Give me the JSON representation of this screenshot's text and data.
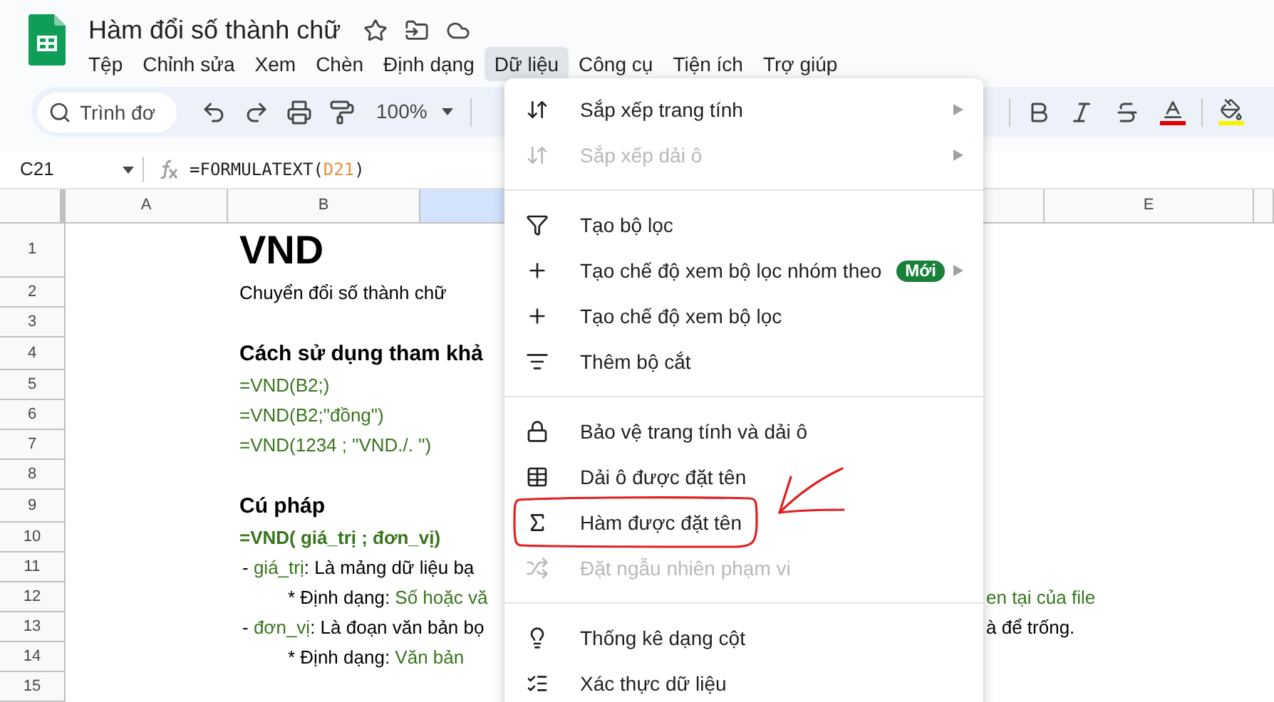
{
  "document": {
    "title": "Hàm đổi số thành chữ"
  },
  "menu_bar": [
    {
      "label": "Tệp",
      "selected": false
    },
    {
      "label": "Chỉnh sửa",
      "selected": false
    },
    {
      "label": "Xem",
      "selected": false
    },
    {
      "label": "Chèn",
      "selected": false
    },
    {
      "label": "Định dạng",
      "selected": false
    },
    {
      "label": "Dữ liệu",
      "selected": true
    },
    {
      "label": "Công cụ",
      "selected": false
    },
    {
      "label": "Tiện ích",
      "selected": false
    },
    {
      "label": "Trợ giúp",
      "selected": false
    }
  ],
  "toolbar": {
    "search": {
      "placeholder": "Trình đơ"
    },
    "zoom": "100%"
  },
  "formula_bar": {
    "name_box": "C21",
    "formula": [
      {
        "text": "=FORMULATEXT(",
        "reference": false
      },
      {
        "text": "D21",
        "reference": true
      },
      {
        "text": ")",
        "reference": false
      }
    ]
  },
  "columns": [
    {
      "label": "A",
      "selected": false
    },
    {
      "label": "B",
      "selected": false
    },
    {
      "selected": true
    },
    {
      "selected": false
    },
    {
      "label": "E",
      "selected": false
    },
    {
      "selected": false
    }
  ],
  "rows": [
    {
      "number": "1",
      "kind": "title",
      "left": [
        {
          "text": "VND",
          "accent": false
        }
      ]
    },
    {
      "number": "2",
      "kind": "normal",
      "left": [
        {
          "text": "Chuyển đổi số thành chữ",
          "accent": false
        }
      ]
    },
    {
      "number": "3",
      "kind": "normal"
    },
    {
      "number": "4",
      "kind": "heading",
      "left": [
        {
          "text": "Cách sử dụng tham khả",
          "accent": false
        }
      ]
    },
    {
      "number": "5",
      "kind": "normal",
      "left": [
        {
          "text": "=VND(B2;)",
          "accent": true
        }
      ]
    },
    {
      "number": "6",
      "kind": "normal",
      "left": [
        {
          "text": "=VND(B2;\"đồng\")",
          "accent": true
        }
      ]
    },
    {
      "number": "7",
      "kind": "normal",
      "left": [
        {
          "text": "=VND(1234 ; \"VND./. \")",
          "accent": true
        }
      ]
    },
    {
      "number": "8",
      "kind": "normal"
    },
    {
      "number": "9",
      "kind": "heading",
      "left": [
        {
          "text": "Cú pháp",
          "accent": false
        }
      ]
    },
    {
      "number": "10",
      "kind": "syntax",
      "left": [
        {
          "text": "=VND( giá_trị ; đơn_vị)",
          "accent": true
        }
      ]
    },
    {
      "number": "11",
      "kind": "item",
      "left": [
        {
          "text": "- ",
          "accent": false
        },
        {
          "text": "giá_trị",
          "accent": true
        },
        {
          "text": ": Là mảng dữ liệu bạ",
          "accent": false
        }
      ]
    },
    {
      "number": "12",
      "kind": "subitem",
      "left": [
        {
          "text": "* Định dạng: ",
          "accent": false
        },
        {
          "text": "Số hoặc vă",
          "accent": true
        }
      ],
      "right": [
        {
          "text": "en tại của file",
          "accent": true
        }
      ]
    },
    {
      "number": "13",
      "kind": "item",
      "left": [
        {
          "text": "- ",
          "accent": false
        },
        {
          "text": "đơn_vị",
          "accent": true
        },
        {
          "text": ": Là đoạn văn bản bọ",
          "accent": false
        }
      ],
      "right": [
        {
          "text": "à để trống.",
          "accent": false
        }
      ]
    },
    {
      "number": "14",
      "kind": "subitem",
      "left": [
        {
          "text": "* Định dạng: ",
          "accent": false
        },
        {
          "text": "Văn bản",
          "accent": true
        }
      ]
    },
    {
      "number": "15",
      "kind": "normal"
    }
  ],
  "data_menu": {
    "sections": [
      {
        "items": [
          {
            "kind": "sort",
            "label": "Sắp xếp trang tính",
            "disabled": false,
            "submenu": true,
            "circled": false
          },
          {
            "kind": "sort",
            "label": "Sắp xếp dải ô",
            "disabled": true,
            "submenu": true,
            "circled": false
          }
        ]
      },
      {
        "items": [
          {
            "kind": "filter",
            "label": "Tạo bộ lọc",
            "disabled": false,
            "submenu": false,
            "circled": false
          },
          {
            "kind": "plus",
            "label": "Tạo chế độ xem bộ lọc nhóm theo",
            "badge": "Mới",
            "disabled": false,
            "submenu": true,
            "circled": false
          },
          {
            "kind": "plus",
            "label": "Tạo chế độ xem bộ lọc",
            "disabled": false,
            "submenu": false,
            "circled": false
          },
          {
            "kind": "slicer",
            "label": "Thêm bộ cắt",
            "disabled": false,
            "submenu": false,
            "circled": false
          }
        ]
      },
      {
        "items": [
          {
            "kind": "lock",
            "label": "Bảo vệ trang tính và dải ô",
            "disabled": false,
            "submenu": false,
            "circled": false
          },
          {
            "kind": "table",
            "label": "Dải ô được đặt tên",
            "disabled": false,
            "submenu": false,
            "circled": false
          },
          {
            "kind": "sigma",
            "label": "Hàm được đặt tên",
            "disabled": false,
            "submenu": false,
            "circled": true
          },
          {
            "kind": "shuffle",
            "label": "Đặt ngẫu nhiên phạm vi",
            "disabled": true,
            "submenu": false,
            "circled": false
          }
        ]
      },
      {
        "items": [
          {
            "kind": "bulb",
            "label": "Thống kê dạng cột",
            "disabled": false,
            "submenu": false,
            "circled": false
          },
          {
            "kind": "validate",
            "label": "Xác thực dữ liệu",
            "disabled": false,
            "submenu": false,
            "circled": false
          }
        ]
      }
    ]
  }
}
